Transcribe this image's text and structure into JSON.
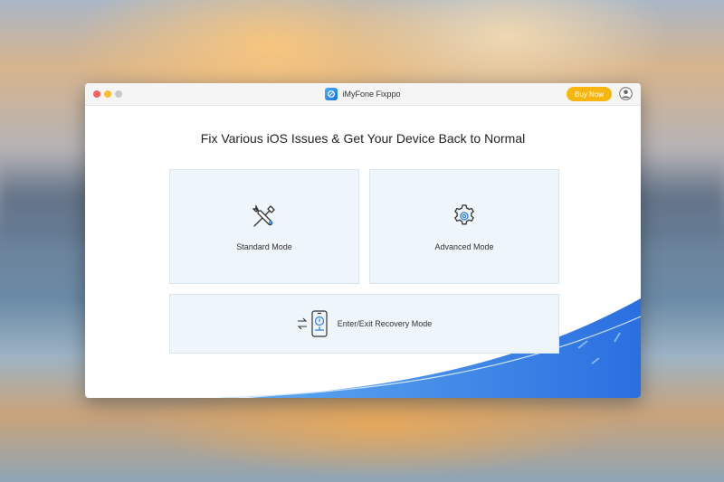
{
  "window": {
    "app_name": "iMyFone Fixppo",
    "buy_label": "Buy Now"
  },
  "main": {
    "headline": "Fix Various iOS Issues & Get Your Device Back to Normal",
    "modes": [
      {
        "label": "Standard Mode",
        "icon": "tools-icon"
      },
      {
        "label": "Advanced Mode",
        "icon": "gear-icon"
      },
      {
        "label": "Enter/Exit Recovery Mode",
        "icon": "recovery-phone-icon"
      }
    ]
  },
  "colors": {
    "accent": "#2a7de1",
    "buy_button": "#f6b50f",
    "card_bg": "#eef5fb"
  }
}
